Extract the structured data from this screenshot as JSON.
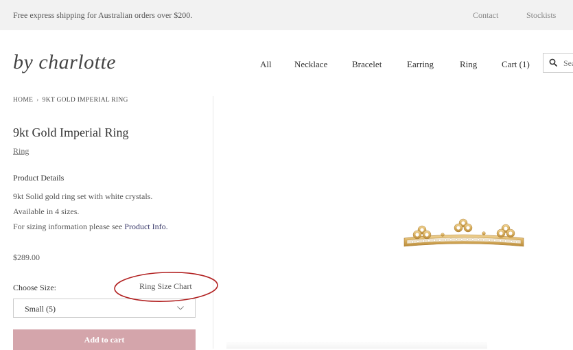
{
  "topbar": {
    "promo": "Free express shipping for Australian orders over $200.",
    "contact": "Contact",
    "stockists": "Stockists"
  },
  "header": {
    "logo": "by charlotte",
    "nav": [
      "All",
      "Necklace",
      "Bracelet",
      "Earring",
      "Ring",
      "Cart (1)"
    ],
    "search_placeholder": "Search"
  },
  "breadcrumb": {
    "home": "HOME",
    "separator": "›",
    "current": "9KT GOLD IMPERIAL RING"
  },
  "product": {
    "title": "9kt Gold Imperial Ring",
    "category": "Ring",
    "details_heading": "Product Details",
    "details_line1": "9kt Solid gold ring set with white crystals.",
    "details_line2": "Available in 4 sizes.",
    "details_line3_prefix": "For sizing information please see ",
    "details_link": "Product Info.",
    "price": "$289.00",
    "size_label": "Choose Size:",
    "size_chart_link": "Ring Size Chart",
    "size_selected": "Small (5)",
    "add_to_cart": "Add to cart"
  },
  "colors": {
    "accent_button": "#d4a5ab",
    "annotation": "#b22222",
    "link": "#3a3a6a"
  }
}
